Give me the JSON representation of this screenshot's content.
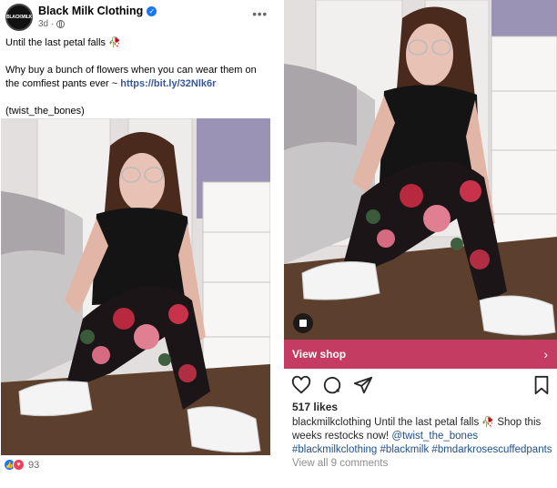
{
  "facebook_post": {
    "page_name": "Black Milk Clothing",
    "avatar_text": "BLACKMILK",
    "time": "3d",
    "separator": "·",
    "caption_line1": "Until the last petal falls",
    "caption_line2": "Why buy a bunch of flowers when you can wear them on the comfiest pants ever ~",
    "link": "https://bit.ly/32Nlk6r",
    "credit": "(twist_the_bones)",
    "reaction_count": "93",
    "icons": [
      "verified-icon",
      "globe-icon",
      "more-icon",
      "rose-emoji",
      "like-icon",
      "love-icon"
    ]
  },
  "instagram_post": {
    "shop_label": "View shop",
    "likes": "517 likes",
    "username": "blackmilkclothing",
    "caption_text": "Until the last petal falls",
    "caption_text2": "Shop this weeks restocks now!",
    "mention": "@twist_the_bones",
    "hashtags": [
      "#blackmilkclothing",
      "#blackmilk",
      "#bmdarkrosescuffedpants"
    ],
    "view_comments": "View all 9 comments",
    "icons": [
      "shopping-bag-icon",
      "heart-icon",
      "comment-icon",
      "share-icon",
      "bookmark-icon",
      "chevron-right-icon"
    ]
  },
  "colors": {
    "facebook_blue": "#1877f2",
    "link_blue": "#385898",
    "shop_banner": "#c43c62",
    "hashtag_blue": "#1f4f8a"
  }
}
